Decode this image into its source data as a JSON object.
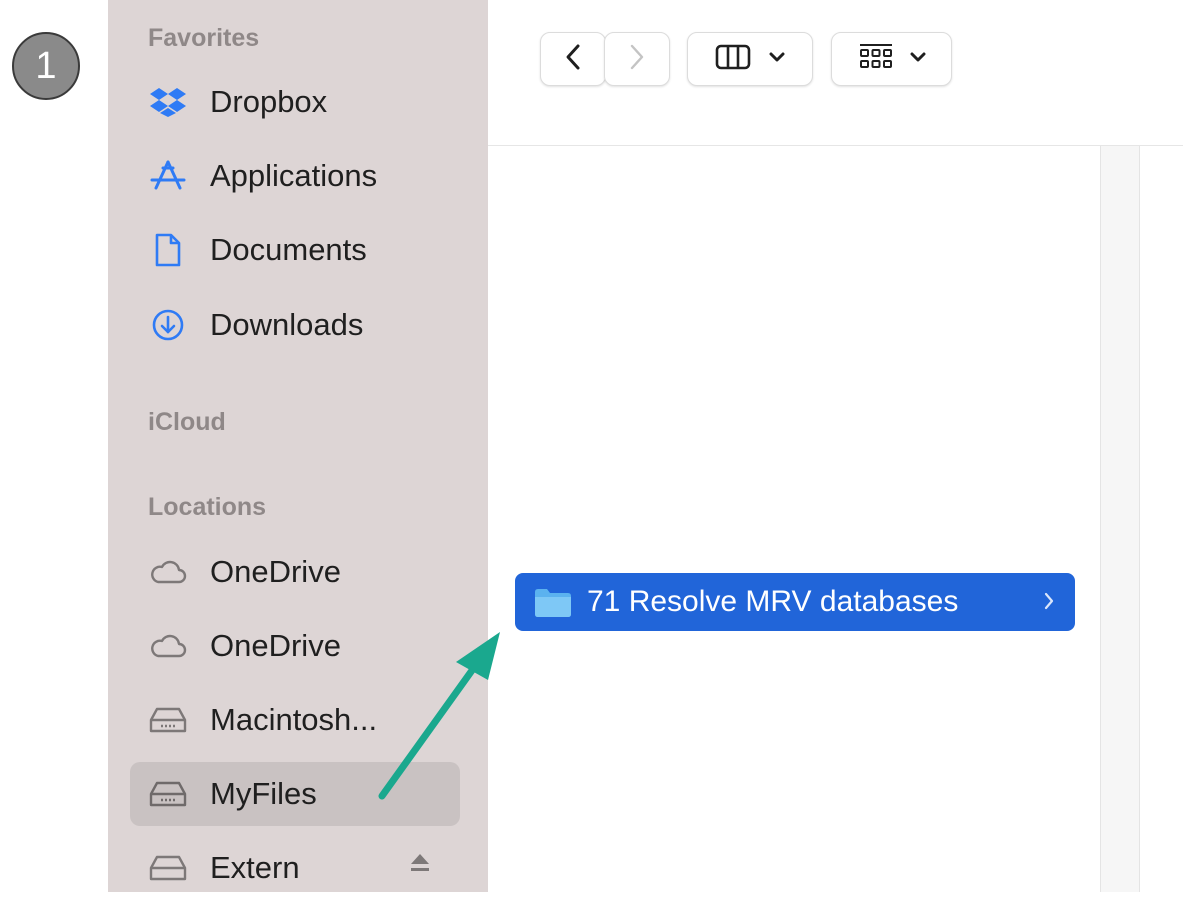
{
  "step_badge": "1",
  "sidebar": {
    "favorites_header": "Favorites",
    "favorites": [
      {
        "label": "Dropbox",
        "icon": "dropbox-icon"
      },
      {
        "label": "Applications",
        "icon": "applications-icon"
      },
      {
        "label": "Documents",
        "icon": "document-icon"
      },
      {
        "label": "Downloads",
        "icon": "download-icon"
      }
    ],
    "icloud_header": "iCloud",
    "locations_header": "Locations",
    "locations": [
      {
        "label": "OneDrive",
        "icon": "cloud-icon"
      },
      {
        "label": "OneDrive",
        "icon": "cloud-icon"
      },
      {
        "label": "Macintosh...",
        "icon": "drive-icon"
      },
      {
        "label": "MyFiles",
        "icon": "drive-icon",
        "selected": true
      },
      {
        "label": "Extern",
        "icon": "drive-icon",
        "ejectable": true
      }
    ]
  },
  "toolbar": {
    "back": "back-chevron-icon",
    "forward": "forward-chevron-icon",
    "view_mode": "columns-view-icon",
    "group_mode": "icon-grid-icon"
  },
  "content": {
    "selected_folder": "71 Resolve MRV databases"
  },
  "colors": {
    "accent": "#2165d9",
    "sidebar_bg": "#ddd5d5",
    "sidebar_selected": "#c9c2c2",
    "annotation_arrow": "#1aa88e",
    "icon_blue": "#2f7bf5"
  }
}
